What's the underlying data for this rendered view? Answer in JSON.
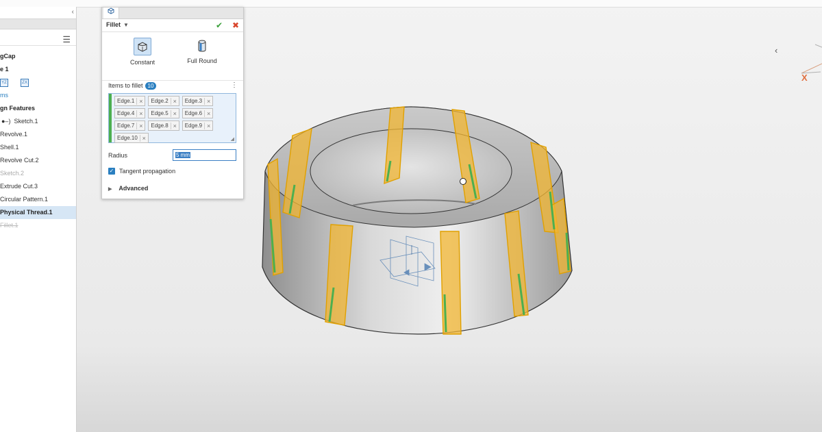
{
  "tree": {
    "items": [
      {
        "label": "gCap",
        "style": "bold"
      },
      {
        "label": "e 1",
        "style": "bold"
      },
      {
        "label": "ms",
        "style": "link"
      },
      {
        "label": "gn Features",
        "style": "bold"
      },
      {
        "label": "Sketch.1",
        "style": "normal"
      },
      {
        "label": "Revolve.1",
        "style": "normal"
      },
      {
        "label": "Shell.1",
        "style": "normal"
      },
      {
        "label": "Revolve Cut.2",
        "style": "normal"
      },
      {
        "label": "Sketch.2",
        "style": "dim"
      },
      {
        "label": "Extrude Cut.3",
        "style": "normal"
      },
      {
        "label": "Circular Pattern.1",
        "style": "normal"
      },
      {
        "label": "Physical Thread.1",
        "style": "selected"
      },
      {
        "label": "Fillet.1",
        "style": "strike"
      }
    ],
    "mini_icons": [
      "YZ",
      "ZX"
    ]
  },
  "dialog": {
    "title": "Fillet",
    "options": [
      {
        "label": "Constant",
        "active": true
      },
      {
        "label": "Full Round",
        "active": false
      }
    ],
    "items_label": "Items to fillet",
    "items_count": "10",
    "edges": [
      "Edge.1",
      "Edge.2",
      "Edge.3",
      "Edge.4",
      "Edge.5",
      "Edge.6",
      "Edge.7",
      "Edge.8",
      "Edge.9",
      "Edge.10"
    ],
    "radius_label": "Radius",
    "radius_value": "5 mm",
    "tangent_label": "Tangent propagation",
    "tangent_checked": true,
    "advanced_label": "Advanced"
  },
  "viewport": {
    "triad_axis": "X"
  },
  "colors": {
    "accent": "#2a7fc0",
    "fillet_edge": "#f2b632",
    "selected_edge": "#4caf50",
    "ok": "#3aa03a",
    "cancel": "#d9452c"
  }
}
